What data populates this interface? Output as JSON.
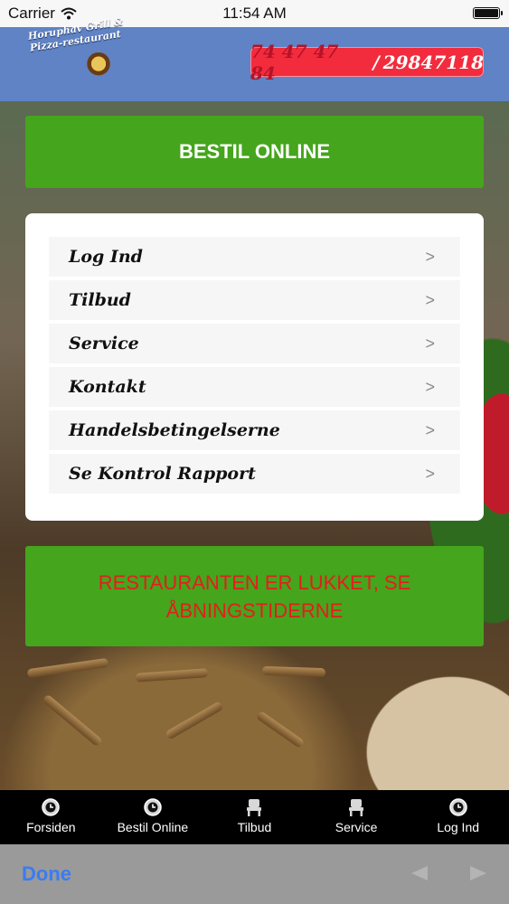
{
  "status_bar": {
    "carrier": "Carrier",
    "time": "11:54 AM"
  },
  "header": {
    "logo_text": "Horuphav Grill & Pizza-restaurant",
    "phone_primary": "74 47 47 84",
    "phone_separator": "/",
    "phone_secondary": "29847118"
  },
  "order_button": {
    "label": "BESTIL ONLINE"
  },
  "menu": {
    "items": [
      {
        "label": "Log Ind",
        "chevron": ">"
      },
      {
        "label": "Tilbud",
        "chevron": ">"
      },
      {
        "label": "Service",
        "chevron": ">"
      },
      {
        "label": "Kontakt",
        "chevron": ">"
      },
      {
        "label": "Handelsbetingelserne",
        "chevron": ">"
      },
      {
        "label": "Se Kontrol Rapport",
        "chevron": ">"
      }
    ]
  },
  "closed_notice": {
    "text": "RESTAURANTEN ER LUKKET, SE ÅBNINGSTIDERNE"
  },
  "tabbar": {
    "tabs": [
      {
        "label": "Forsiden",
        "icon": "clock-icon"
      },
      {
        "label": "Bestil Online",
        "icon": "clock-icon"
      },
      {
        "label": "Tilbud",
        "icon": "chair-icon"
      },
      {
        "label": "Service",
        "icon": "chair-icon"
      },
      {
        "label": "Log Ind",
        "icon": "clock-icon"
      }
    ]
  },
  "toolbar": {
    "done_label": "Done"
  },
  "colors": {
    "header_blue": "#5f83c4",
    "green": "#45a51c",
    "phone_red": "#f22c3d",
    "closed_text_red": "#e31e1e",
    "done_blue": "#3b7cf0"
  }
}
